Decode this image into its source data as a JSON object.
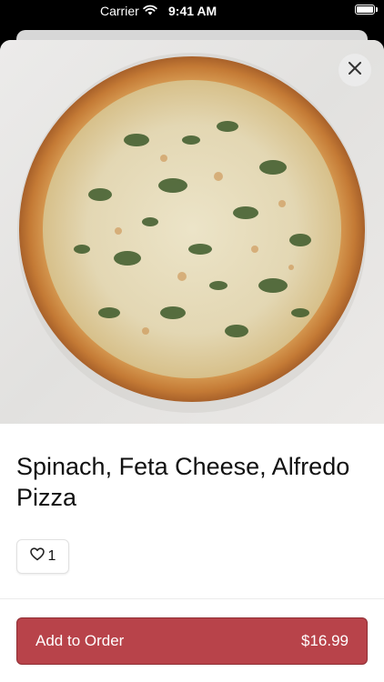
{
  "status_bar": {
    "carrier": "Carrier",
    "time": "9:41 AM"
  },
  "item": {
    "title": "Spinach, Feta Cheese, Alfredo Pizza",
    "likes": "1"
  },
  "order": {
    "button_label": "Add to Order",
    "price": "$16.99"
  },
  "colors": {
    "accent": "#b8434a"
  },
  "icons": {
    "close": "close-icon",
    "like": "heart-icon",
    "wifi": "wifi-icon",
    "battery": "battery-icon"
  }
}
